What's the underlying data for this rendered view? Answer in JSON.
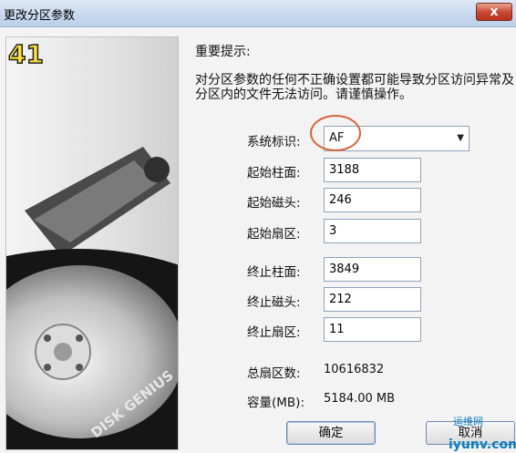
{
  "window": {
    "title": "更改分区参数",
    "close_label": "x"
  },
  "sidebar": {
    "badge": "41",
    "brand": "DISK GENIUS"
  },
  "notice": {
    "title": "重要提示:",
    "body": "对分区参数的任何不正确设置都可能导致分区访问异常及分区内的文件无法访问。请谨慎操作。"
  },
  "form": {
    "system_id": {
      "label": "系统标识:",
      "value": "AF"
    },
    "start_cylinder": {
      "label": "起始柱面:",
      "value": "3188"
    },
    "start_head": {
      "label": "起始磁头:",
      "value": "246"
    },
    "start_sector": {
      "label": "起始扇区:",
      "value": "3"
    },
    "end_cylinder": {
      "label": "终止柱面:",
      "value": "3849"
    },
    "end_head": {
      "label": "终止磁头:",
      "value": "212"
    },
    "end_sector": {
      "label": "终止扇区:",
      "value": "11"
    },
    "total_sectors": {
      "label": "总扇区数:",
      "value": "10616832"
    },
    "capacity": {
      "label": "容量(MB):",
      "value": "5184.00 MB"
    }
  },
  "buttons": {
    "ok": "确定",
    "cancel": "取消"
  },
  "watermark": {
    "text": "运维网",
    "url": "iyunv.com"
  },
  "colors": {
    "title_bar": "#c9d9ee",
    "accent_ring": "#d6633a",
    "button_border": "#6e8bb3"
  }
}
